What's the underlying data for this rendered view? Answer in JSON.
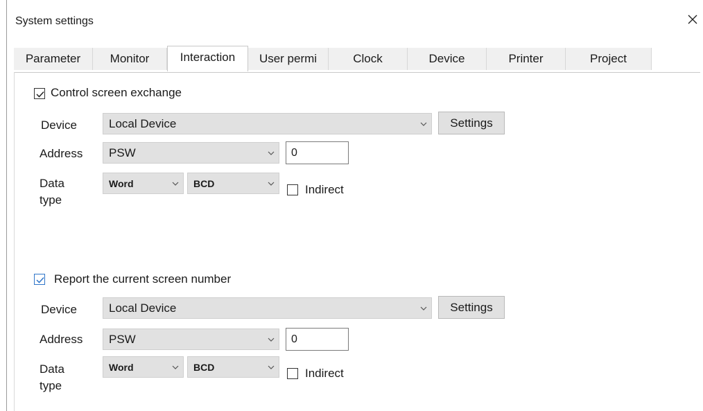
{
  "window": {
    "title": "System settings",
    "close_icon": "close-icon"
  },
  "tabs": [
    {
      "label": "Parameter"
    },
    {
      "label": "Monitor"
    },
    {
      "label": "Interaction",
      "active": true
    },
    {
      "label": "User permi"
    },
    {
      "label": "Clock"
    },
    {
      "label": "Device"
    },
    {
      "label": "Printer"
    },
    {
      "label": "Project"
    }
  ],
  "section1": {
    "checkbox_label": "Control screen exchange",
    "checked": true,
    "device_label": "Device",
    "device_value": "Local Device",
    "settings_label": "Settings",
    "address_label": "Address",
    "address_value": "PSW",
    "address_offset": "0",
    "datatype_label_line1": "Data",
    "datatype_label_line2": "type",
    "datatype_value": "Word",
    "format_value": "BCD",
    "indirect_label": "Indirect",
    "indirect_checked": false
  },
  "section2": {
    "checkbox_label": "Report the current screen number",
    "checked": true,
    "device_label": "Device",
    "device_value": "Local Device",
    "settings_label": "Settings",
    "address_label": "Address",
    "address_value": "PSW",
    "address_offset": "0",
    "datatype_label_line1": "Data",
    "datatype_label_line2": "type",
    "datatype_value": "Word",
    "format_value": "BCD",
    "indirect_label": "Indirect",
    "indirect_checked": false
  },
  "colors": {
    "checkbox_blue": "#2f75c9",
    "combo_bg": "#e1e1e1",
    "tab_bg": "#f0f0f0"
  }
}
